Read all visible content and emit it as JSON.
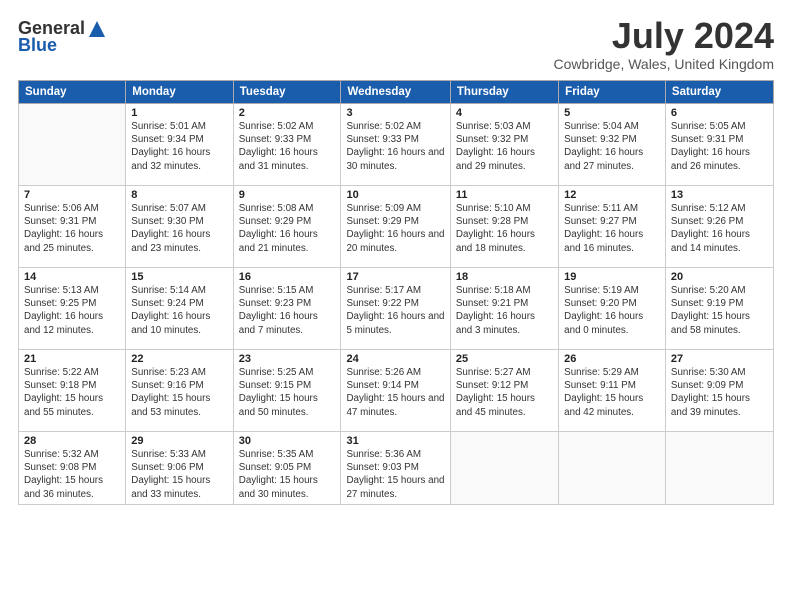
{
  "header": {
    "logo_general": "General",
    "logo_blue": "Blue",
    "month_year": "July 2024",
    "location": "Cowbridge, Wales, United Kingdom"
  },
  "days_of_week": [
    "Sunday",
    "Monday",
    "Tuesday",
    "Wednesday",
    "Thursday",
    "Friday",
    "Saturday"
  ],
  "weeks": [
    [
      {
        "day": "",
        "info": ""
      },
      {
        "day": "1",
        "info": "Sunrise: 5:01 AM\nSunset: 9:34 PM\nDaylight: 16 hours\nand 32 minutes."
      },
      {
        "day": "2",
        "info": "Sunrise: 5:02 AM\nSunset: 9:33 PM\nDaylight: 16 hours\nand 31 minutes."
      },
      {
        "day": "3",
        "info": "Sunrise: 5:02 AM\nSunset: 9:33 PM\nDaylight: 16 hours\nand 30 minutes."
      },
      {
        "day": "4",
        "info": "Sunrise: 5:03 AM\nSunset: 9:32 PM\nDaylight: 16 hours\nand 29 minutes."
      },
      {
        "day": "5",
        "info": "Sunrise: 5:04 AM\nSunset: 9:32 PM\nDaylight: 16 hours\nand 27 minutes."
      },
      {
        "day": "6",
        "info": "Sunrise: 5:05 AM\nSunset: 9:31 PM\nDaylight: 16 hours\nand 26 minutes."
      }
    ],
    [
      {
        "day": "7",
        "info": "Sunrise: 5:06 AM\nSunset: 9:31 PM\nDaylight: 16 hours\nand 25 minutes."
      },
      {
        "day": "8",
        "info": "Sunrise: 5:07 AM\nSunset: 9:30 PM\nDaylight: 16 hours\nand 23 minutes."
      },
      {
        "day": "9",
        "info": "Sunrise: 5:08 AM\nSunset: 9:29 PM\nDaylight: 16 hours\nand 21 minutes."
      },
      {
        "day": "10",
        "info": "Sunrise: 5:09 AM\nSunset: 9:29 PM\nDaylight: 16 hours\nand 20 minutes."
      },
      {
        "day": "11",
        "info": "Sunrise: 5:10 AM\nSunset: 9:28 PM\nDaylight: 16 hours\nand 18 minutes."
      },
      {
        "day": "12",
        "info": "Sunrise: 5:11 AM\nSunset: 9:27 PM\nDaylight: 16 hours\nand 16 minutes."
      },
      {
        "day": "13",
        "info": "Sunrise: 5:12 AM\nSunset: 9:26 PM\nDaylight: 16 hours\nand 14 minutes."
      }
    ],
    [
      {
        "day": "14",
        "info": "Sunrise: 5:13 AM\nSunset: 9:25 PM\nDaylight: 16 hours\nand 12 minutes."
      },
      {
        "day": "15",
        "info": "Sunrise: 5:14 AM\nSunset: 9:24 PM\nDaylight: 16 hours\nand 10 minutes."
      },
      {
        "day": "16",
        "info": "Sunrise: 5:15 AM\nSunset: 9:23 PM\nDaylight: 16 hours\nand 7 minutes."
      },
      {
        "day": "17",
        "info": "Sunrise: 5:17 AM\nSunset: 9:22 PM\nDaylight: 16 hours\nand 5 minutes."
      },
      {
        "day": "18",
        "info": "Sunrise: 5:18 AM\nSunset: 9:21 PM\nDaylight: 16 hours\nand 3 minutes."
      },
      {
        "day": "19",
        "info": "Sunrise: 5:19 AM\nSunset: 9:20 PM\nDaylight: 16 hours\nand 0 minutes."
      },
      {
        "day": "20",
        "info": "Sunrise: 5:20 AM\nSunset: 9:19 PM\nDaylight: 15 hours\nand 58 minutes."
      }
    ],
    [
      {
        "day": "21",
        "info": "Sunrise: 5:22 AM\nSunset: 9:18 PM\nDaylight: 15 hours\nand 55 minutes."
      },
      {
        "day": "22",
        "info": "Sunrise: 5:23 AM\nSunset: 9:16 PM\nDaylight: 15 hours\nand 53 minutes."
      },
      {
        "day": "23",
        "info": "Sunrise: 5:25 AM\nSunset: 9:15 PM\nDaylight: 15 hours\nand 50 minutes."
      },
      {
        "day": "24",
        "info": "Sunrise: 5:26 AM\nSunset: 9:14 PM\nDaylight: 15 hours\nand 47 minutes."
      },
      {
        "day": "25",
        "info": "Sunrise: 5:27 AM\nSunset: 9:12 PM\nDaylight: 15 hours\nand 45 minutes."
      },
      {
        "day": "26",
        "info": "Sunrise: 5:29 AM\nSunset: 9:11 PM\nDaylight: 15 hours\nand 42 minutes."
      },
      {
        "day": "27",
        "info": "Sunrise: 5:30 AM\nSunset: 9:09 PM\nDaylight: 15 hours\nand 39 minutes."
      }
    ],
    [
      {
        "day": "28",
        "info": "Sunrise: 5:32 AM\nSunset: 9:08 PM\nDaylight: 15 hours\nand 36 minutes."
      },
      {
        "day": "29",
        "info": "Sunrise: 5:33 AM\nSunset: 9:06 PM\nDaylight: 15 hours\nand 33 minutes."
      },
      {
        "day": "30",
        "info": "Sunrise: 5:35 AM\nSunset: 9:05 PM\nDaylight: 15 hours\nand 30 minutes."
      },
      {
        "day": "31",
        "info": "Sunrise: 5:36 AM\nSunset: 9:03 PM\nDaylight: 15 hours\nand 27 minutes."
      },
      {
        "day": "",
        "info": ""
      },
      {
        "day": "",
        "info": ""
      },
      {
        "day": "",
        "info": ""
      }
    ]
  ]
}
